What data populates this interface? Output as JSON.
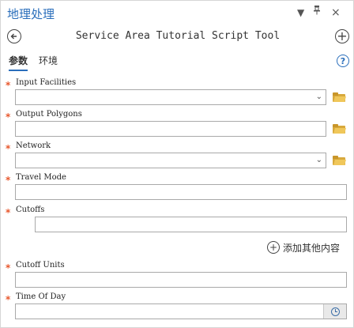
{
  "pane": {
    "title": "地理处理",
    "controls": {
      "menu": "▼",
      "pin": "🖈",
      "close": "×"
    }
  },
  "toolbar": {
    "back_icon": "⟵",
    "tool_title": "Service Area Tutorial Script Tool",
    "add_icon": "+"
  },
  "tabs": [
    {
      "label": "参数",
      "active": true
    },
    {
      "label": "环境",
      "active": false
    }
  ],
  "help_icon": "?",
  "parameters": [
    {
      "label": "Input Facilities",
      "required": true,
      "type": "dropdown",
      "value": "",
      "browse": true
    },
    {
      "label": "Output Polygons",
      "required": true,
      "type": "text",
      "value": "",
      "browse": true
    },
    {
      "label": "Network",
      "required": true,
      "type": "dropdown",
      "value": "",
      "browse": true
    },
    {
      "label": "Travel Mode",
      "required": true,
      "type": "text",
      "value": "",
      "browse": false
    },
    {
      "label": "Cutoffs",
      "required": true,
      "type": "text",
      "value": "",
      "browse": false
    },
    {
      "label": "Cutoff Units",
      "required": true,
      "type": "text",
      "value": "",
      "browse": false
    },
    {
      "label": "Time Of Day",
      "required": true,
      "type": "datetime",
      "value": "",
      "browse": false
    }
  ],
  "add_more": {
    "label": "添加其他内容"
  },
  "required_marker": "*",
  "dropdown_arrow": "⌄",
  "colors": {
    "accent": "#2a6ebb",
    "required": "#e8572c",
    "folder": "#f0c75a"
  }
}
